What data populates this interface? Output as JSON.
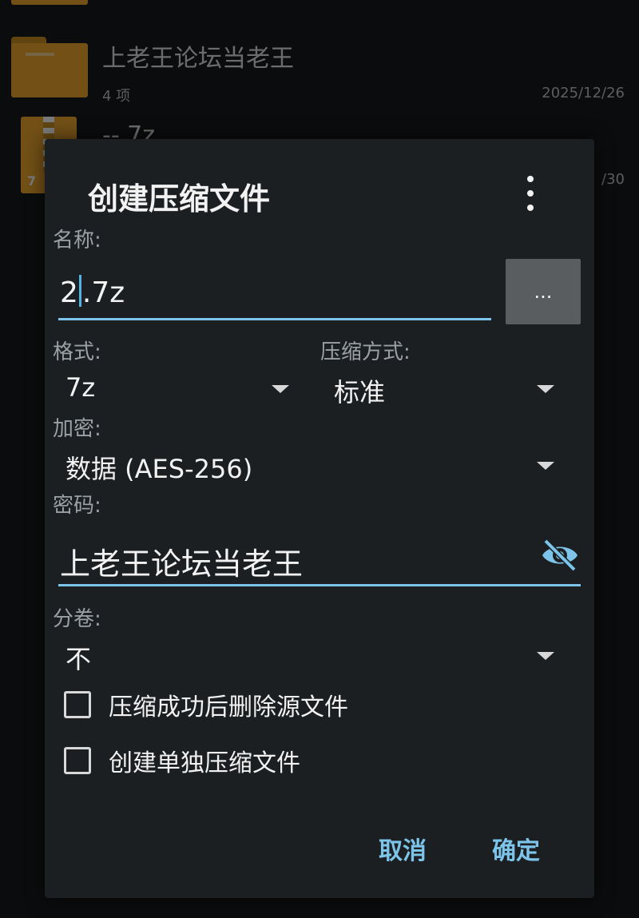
{
  "background": {
    "rows": [
      {
        "name": "上老王论坛当老王",
        "meta": "4 项",
        "date": "2025/12/26"
      },
      {
        "name": "-- 7z",
        "meta": "",
        "date": "/30"
      }
    ],
    "archive_icon_label": "7"
  },
  "dialog": {
    "title": "创建压缩文件",
    "name_label": "名称:",
    "name_value_before_caret": "2",
    "name_value_after_caret": ".7z",
    "browse_label": "...",
    "format_label": "格式:",
    "format_value": "7z",
    "method_label": "压缩方式:",
    "method_value": "标准",
    "encryption_label": "加密:",
    "encryption_value": "数据 (AES-256)",
    "password_label": "密码:",
    "password_value": "上老王论坛当老王",
    "split_label": "分卷:",
    "split_value": "不",
    "checkbox_delete": "压缩成功后删除源文件",
    "checkbox_separate": "创建单独压缩文件",
    "cancel": "取消",
    "ok": "确定"
  },
  "colors": {
    "accent": "#7cc4ea",
    "dialog_bg": "#1c1f22",
    "folder": "#f0a423"
  }
}
